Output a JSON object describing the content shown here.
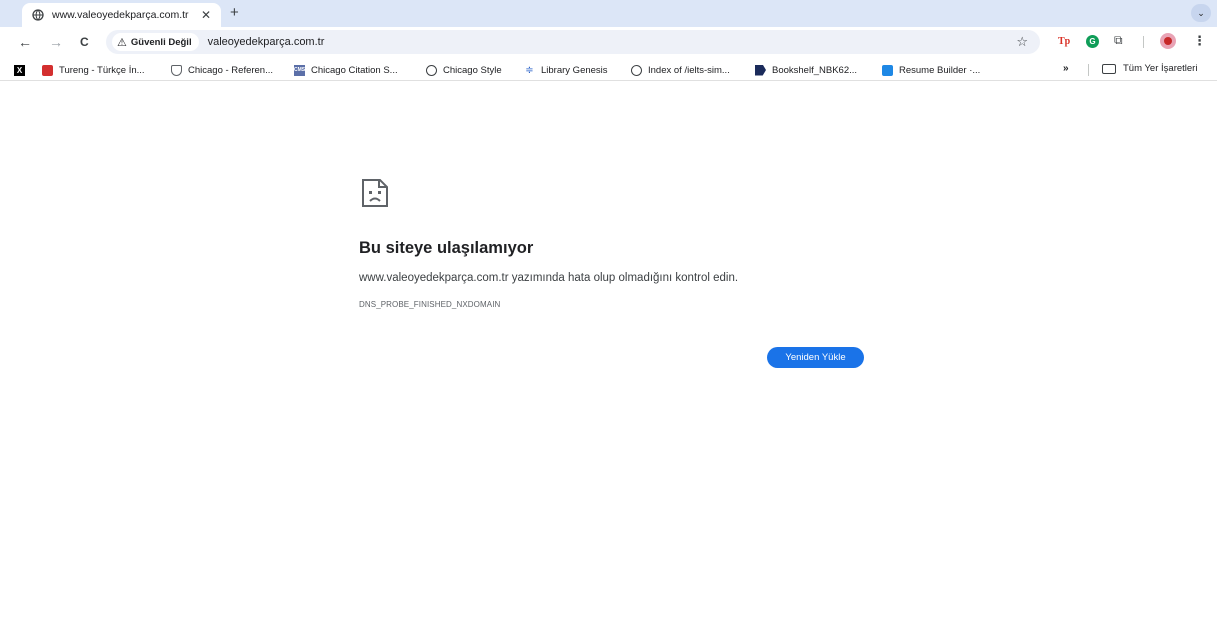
{
  "tab": {
    "title": "www.valeoyedekparça.com.tr",
    "favicon": "globe-icon",
    "close_glyph": "✕",
    "new_tab_glyph": "+"
  },
  "tab_search_glyph": "⌄",
  "toolbar": {
    "back_glyph": "←",
    "forward_glyph": "→",
    "reload_glyph": "C",
    "security_warning_glyph": "⚠",
    "security_label": "Güvenli Değil",
    "url": "valeoyedekparça.com.tr",
    "star_glyph": "☆",
    "extensions": {
      "tp_label": "Tp",
      "grammarly_label": "G",
      "puzzle_glyph": "⧉"
    },
    "menu_glyph": "⋮"
  },
  "bookmarks": {
    "items": [
      {
        "label": "",
        "icon": "x-icon"
      },
      {
        "label": "Tureng - Türkçe İn...",
        "icon": "tureng-icon"
      },
      {
        "label": "Chicago - Referen...",
        "icon": "shield-icon"
      },
      {
        "label": "Chicago Citation S...",
        "icon": "cms-icon"
      },
      {
        "label": "Chicago Style",
        "icon": "globe-icon"
      },
      {
        "label": "Library Genesis",
        "icon": "library-icon"
      },
      {
        "label": "Index of /ielts-sim...",
        "icon": "globe-icon"
      },
      {
        "label": "Bookshelf_NBK62...",
        "icon": "bookshelf-icon"
      },
      {
        "label": "Resume Builder ·...",
        "icon": "resume-icon"
      }
    ],
    "more_glyph": "»",
    "all_bookmarks_label": "Tüm Yer İşaretleri"
  },
  "error_page": {
    "icon": "sad-page-icon",
    "title": "Bu siteye ulaşılamıyor",
    "message": "www.valeoyedekparça.com.tr yazımında hata olup olmadığını kontrol edin.",
    "error_code": "DNS_PROBE_FINISHED_NXDOMAIN",
    "reload_button_label": "Yeniden Yükle"
  },
  "colors": {
    "tabstrip_bg": "#dce6f7",
    "omnibox_bg": "#eef1f8",
    "accent": "#1a73e8"
  }
}
